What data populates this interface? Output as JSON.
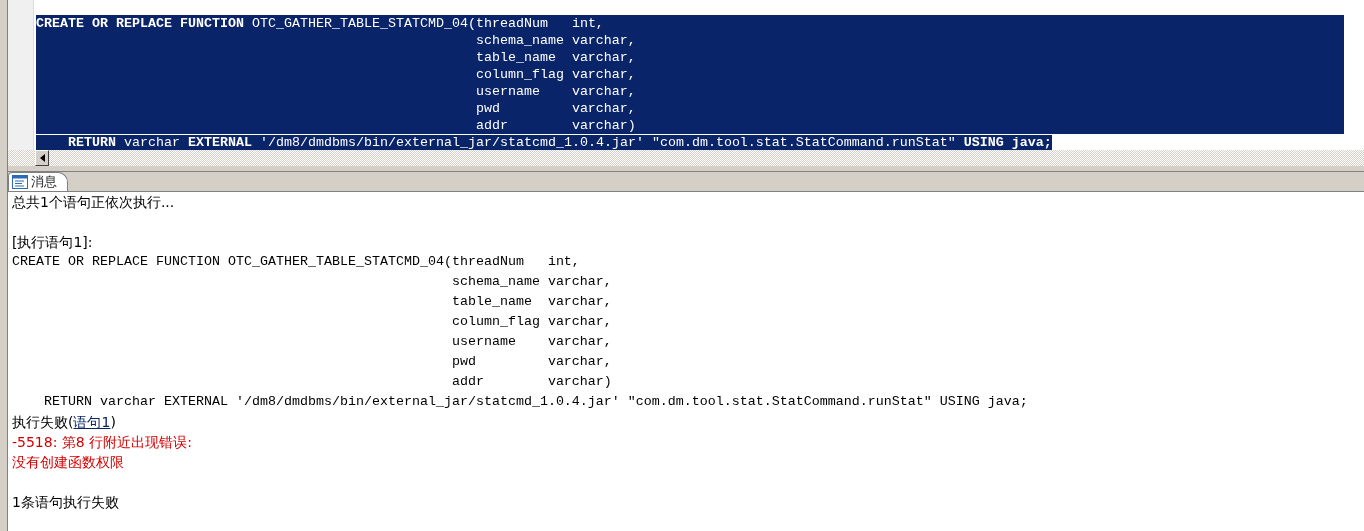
{
  "editor": {
    "lines": [
      {
        "text": "**CREATE OR REPLACE FUNCTION** OTC_GATHER_TABLE_STATCMD_04(threadNum   int,",
        "selected": true
      },
      {
        "text": "                                                       schema_name varchar,",
        "selected": true
      },
      {
        "text": "                                                       table_name  varchar,",
        "selected": true
      },
      {
        "text": "                                                       column_flag varchar,",
        "selected": true
      },
      {
        "text": "                                                       username    varchar,",
        "selected": true
      },
      {
        "text": "                                                       pwd         varchar,",
        "selected": true
      },
      {
        "text": "                                                       addr        varchar)",
        "selected": true
      },
      {
        "text": "    **RETURN** varchar **EXTERNAL** '/dm8/dmdbms/bin/external_jar/statcmd_1.0.4.jar' \"com.dm.tool.stat.StatCommand.runStat\" **USING java;**",
        "selected": true
      }
    ]
  },
  "tabs": [
    {
      "label": "消息",
      "selected": true
    }
  ],
  "messages": [
    {
      "kind": "text",
      "text": "总共1个语句正依次执行..."
    },
    {
      "kind": "blank"
    },
    {
      "kind": "text",
      "text": "[执行语句1]:"
    },
    {
      "kind": "code",
      "text": "CREATE OR REPLACE FUNCTION OTC_GATHER_TABLE_STATCMD_04(threadNum   int,"
    },
    {
      "kind": "code",
      "text": "                                                       schema_name varchar,"
    },
    {
      "kind": "code",
      "text": "                                                       table_name  varchar,"
    },
    {
      "kind": "code",
      "text": "                                                       column_flag varchar,"
    },
    {
      "kind": "code",
      "text": "                                                       username    varchar,"
    },
    {
      "kind": "code",
      "text": "                                                       pwd         varchar,"
    },
    {
      "kind": "code",
      "text": "                                                       addr        varchar)"
    },
    {
      "kind": "code",
      "text": "    RETURN varchar EXTERNAL '/dm8/dmdbms/bin/external_jar/statcmd_1.0.4.jar' \"com.dm.tool.stat.StatCommand.runStat\" USING java;"
    },
    {
      "kind": "text",
      "parts": [
        {
          "text": "执行失败("
        },
        {
          "text": "语句1",
          "link": true
        },
        {
          "text": ")"
        }
      ]
    },
    {
      "kind": "error",
      "text": "-5518: 第8 行附近出现错误:"
    },
    {
      "kind": "error",
      "text": "没有创建函数权限"
    },
    {
      "kind": "blank"
    },
    {
      "kind": "text",
      "text": "1条语句执行失败"
    }
  ]
}
